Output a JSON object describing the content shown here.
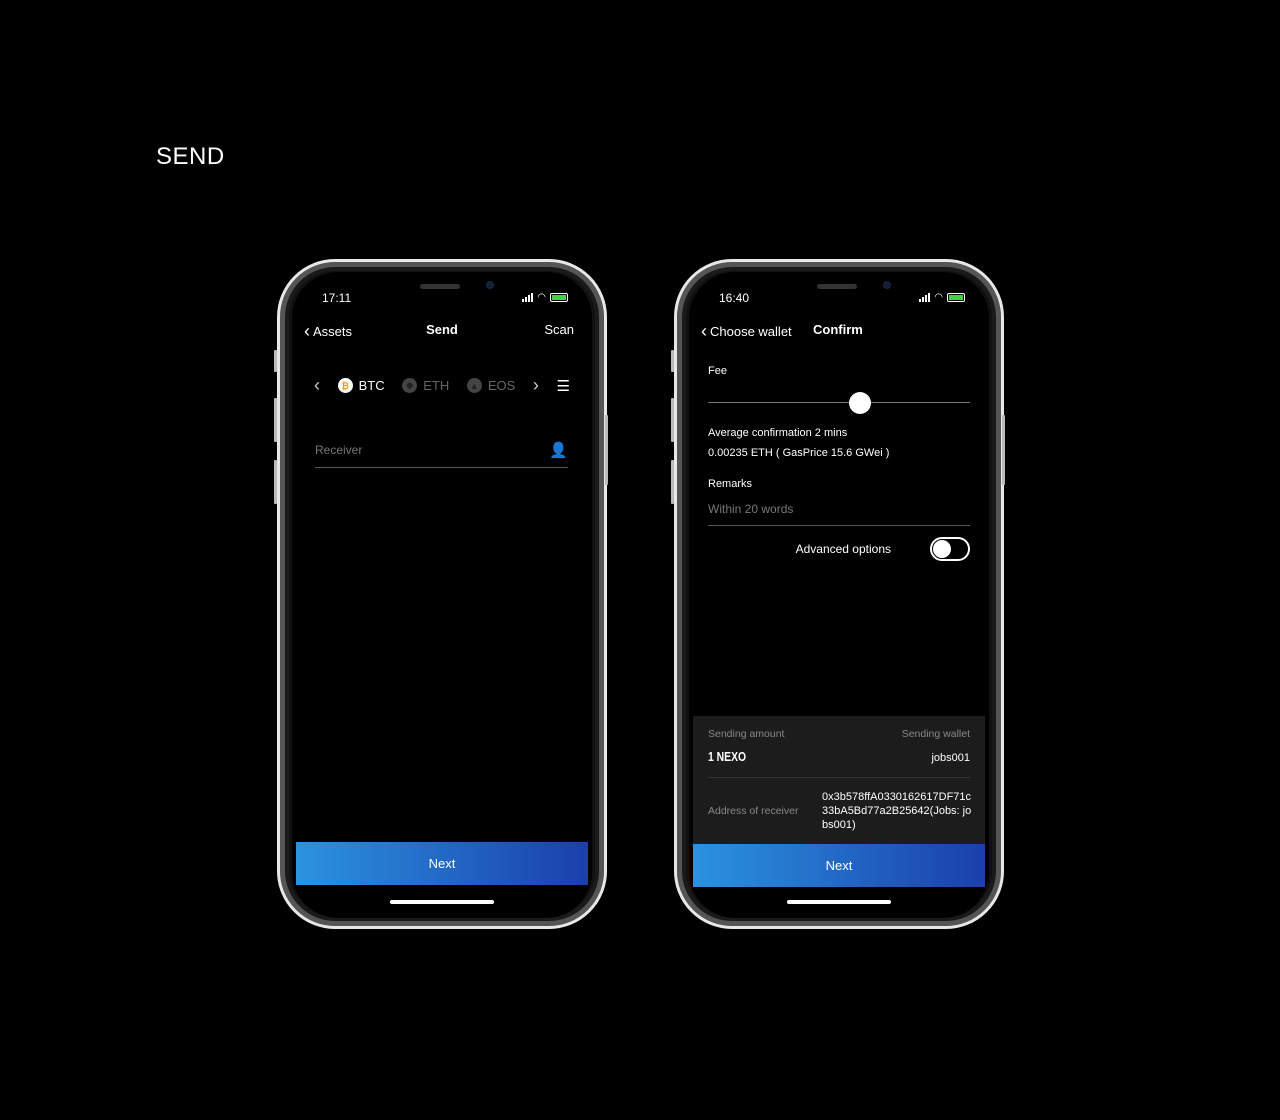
{
  "page_title": "SEND",
  "left": {
    "time": "17:11",
    "nav": {
      "back": "Assets",
      "title": "Send",
      "action": "Scan"
    },
    "coins": [
      {
        "symbol": "BTC",
        "active": true
      },
      {
        "symbol": "ETH",
        "active": false
      },
      {
        "symbol": "EOS",
        "active": false
      }
    ],
    "receiver_placeholder": "Receiver",
    "next": "Next"
  },
  "right": {
    "time": "16:40",
    "nav": {
      "back": "Choose wallet",
      "title": "Confirm"
    },
    "fee_label": "Fee",
    "fee_level": 0.58,
    "avg_confirm": "Average confirmation 2 mins",
    "fee_value": "0.00235 ETH ( GasPrice 15.6 GWei )",
    "remarks_label": "Remarks",
    "remarks_placeholder": "Within 20 words",
    "advanced_label": "Advanced options",
    "advanced_on": false,
    "summary": {
      "amount_label": "Sending amount",
      "amount": "1 NEXO",
      "wallet_label": "Sending wallet",
      "wallet": "jobs001",
      "address_label": "Address of receiver",
      "address": "0x3b578ffA0330162617DF71c33bA5Bd77a2B25642(Jobs: jobs001)"
    },
    "next": "Next"
  },
  "colors": {
    "accent_start": "#2b93e0",
    "accent_end": "#1a3fab",
    "btc": "#f7931a",
    "battery": "#3ed34b"
  }
}
